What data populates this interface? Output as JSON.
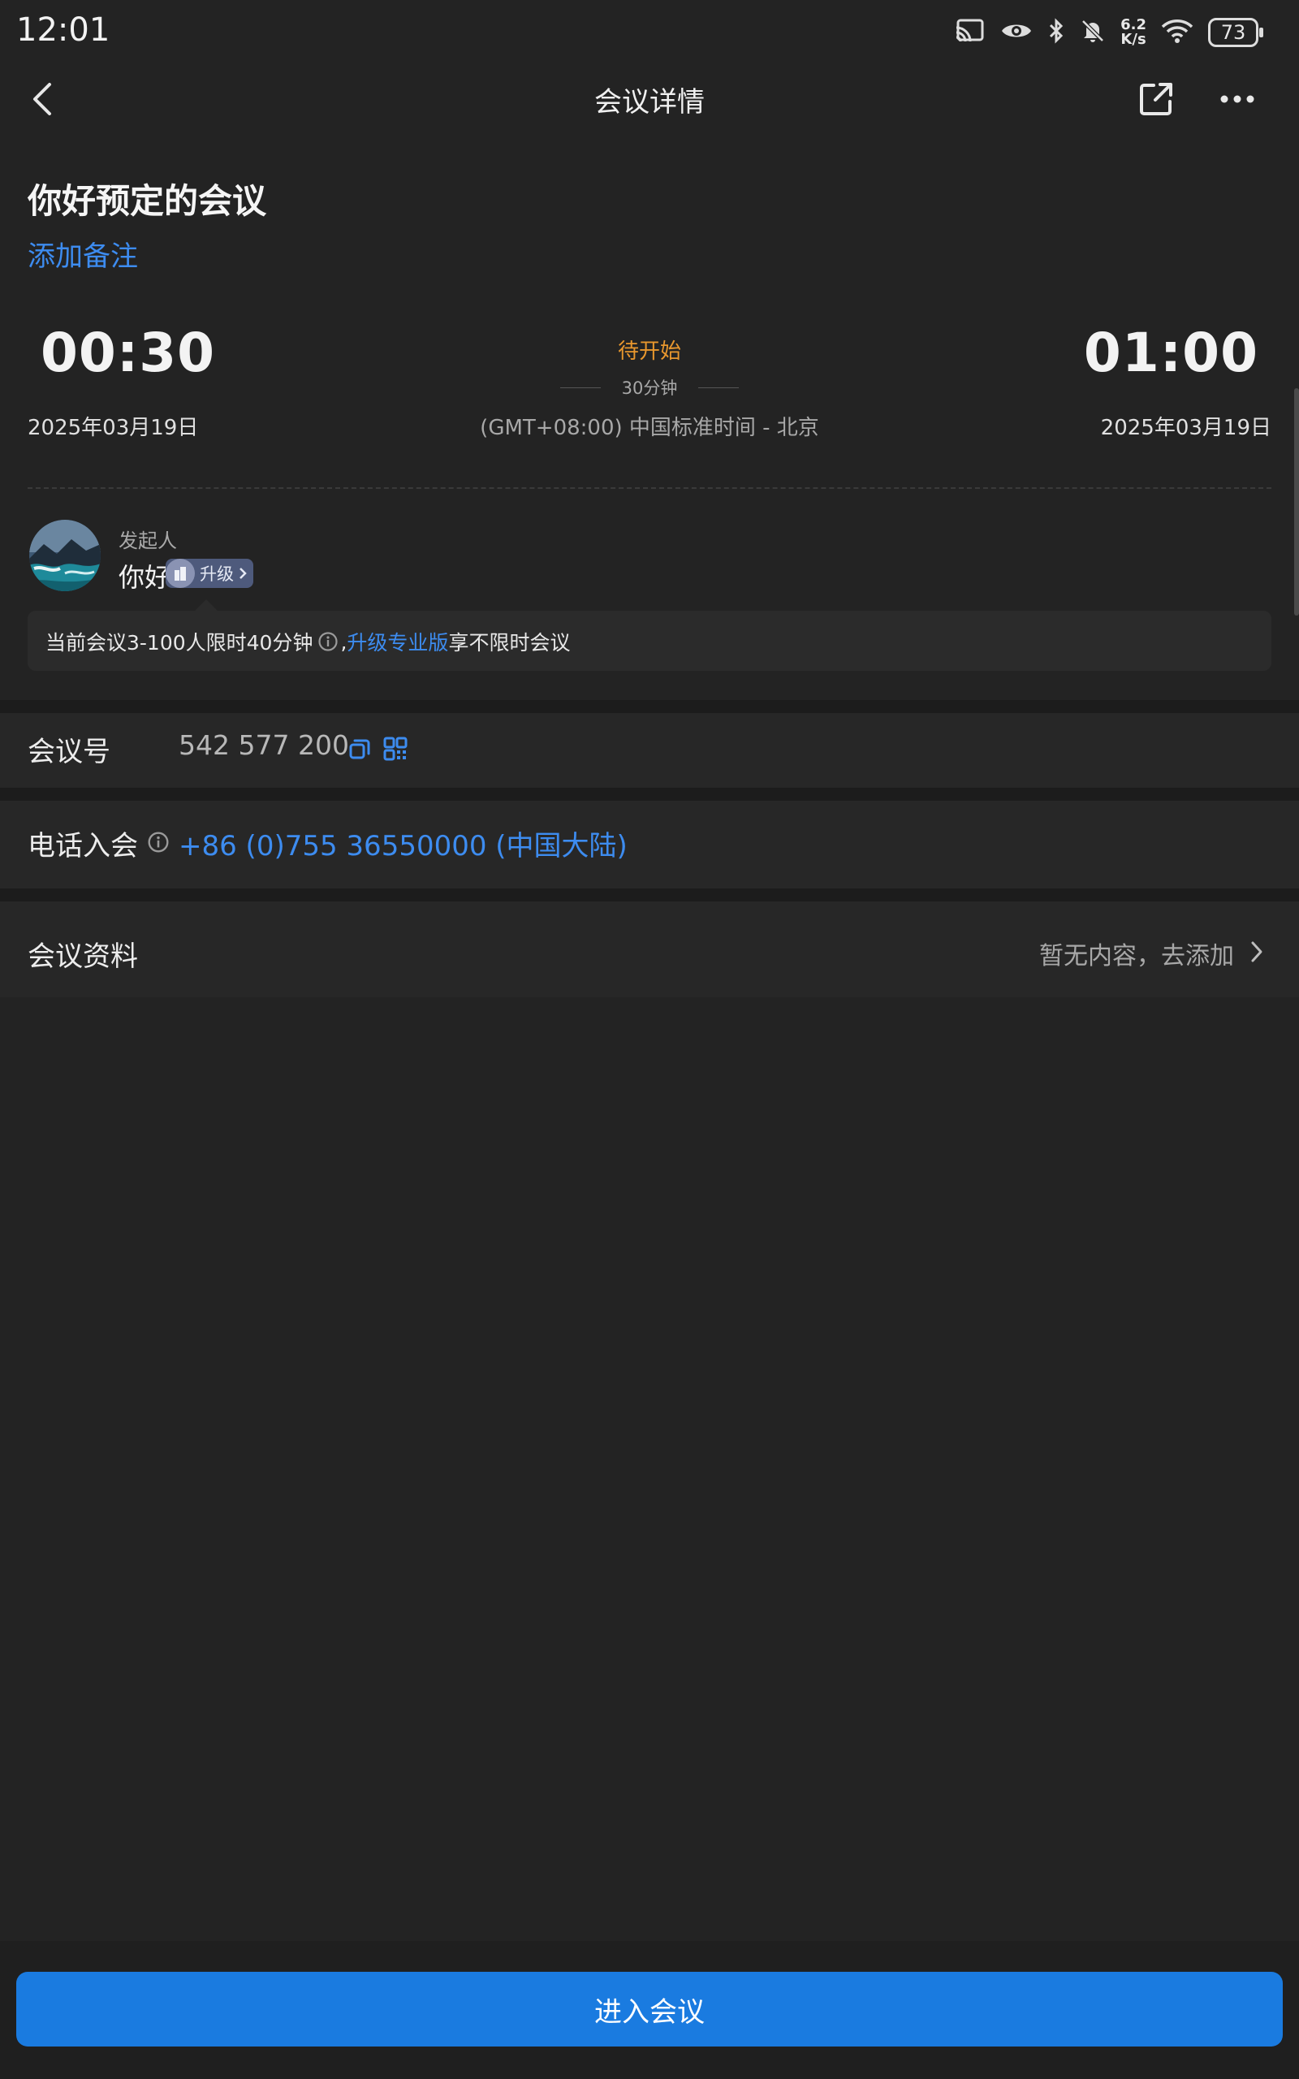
{
  "status_bar": {
    "time": "12:01",
    "net_speed_value": "6.2",
    "net_speed_unit": "K/s",
    "battery": "73",
    "icons": [
      "cast-icon",
      "eye-icon",
      "bluetooth-icon",
      "bell-off-icon",
      "wifi-icon",
      "battery-icon"
    ]
  },
  "nav": {
    "title": "会议详情",
    "icons": [
      "back-icon",
      "share-icon",
      "more-icon"
    ]
  },
  "meeting": {
    "title": "你好预定的会议",
    "add_note": "添加备注",
    "start_time": "00:30",
    "start_date": "2025年03月19日",
    "end_time": "01:00",
    "end_date": "2025年03月19日",
    "status": "待开始",
    "duration": "30分钟",
    "timezone": "(GMT+08:00) 中国标准时间 - 北京"
  },
  "organizer": {
    "label": "发起人",
    "name": "你好",
    "upgrade_label": "升级"
  },
  "tip": {
    "text_before": "当前会议3-100人限时40分钟",
    "comma": ",",
    "link": "升级专业版",
    "text_after": "享不限时会议"
  },
  "meeting_number": {
    "label": "会议号",
    "value": "542 577 200"
  },
  "phone_dial": {
    "label": "电话入会",
    "number": "+86 (0)755 36550000 (中国大陆)"
  },
  "materials": {
    "label": "会议资料",
    "action": "暂无内容，去添加"
  },
  "join_button": "进入会议",
  "colors": {
    "background": "#232323",
    "accent": "#1a7be0",
    "link": "#3d8cf0",
    "status_pending": "#e8972e"
  }
}
